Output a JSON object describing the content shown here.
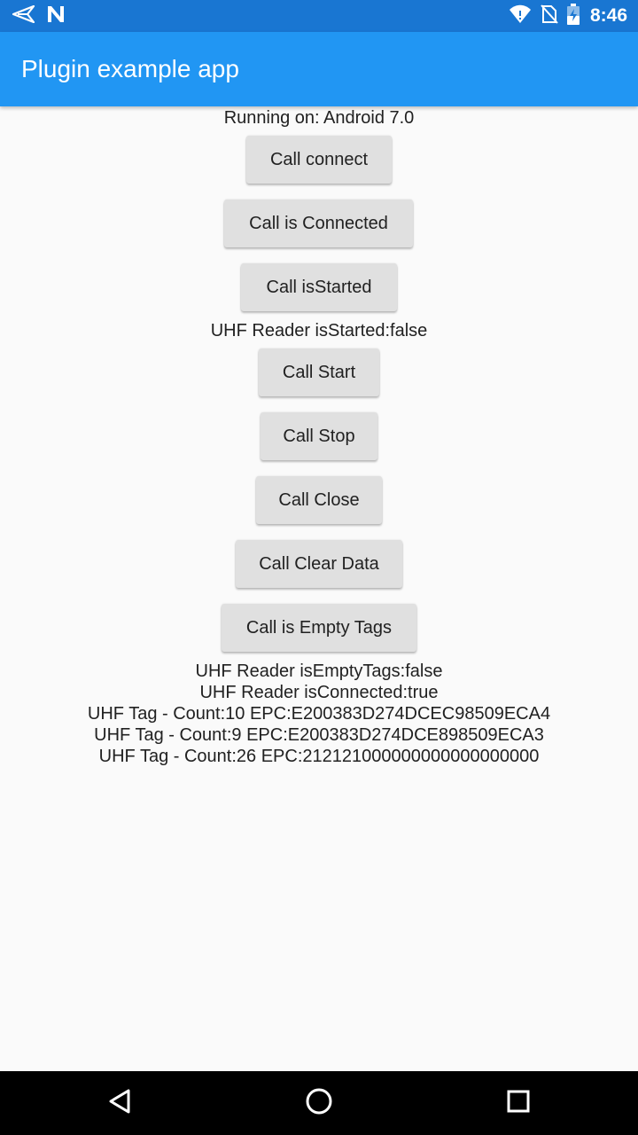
{
  "status_bar": {
    "time": "8:46",
    "icons": [
      "send-icon",
      "n-notification-icon",
      "wifi-icon",
      "no-sim-icon",
      "battery-charging-icon"
    ]
  },
  "app_bar": {
    "title": "Plugin example app",
    "color": "#2196F3",
    "status_color": "#1976D2"
  },
  "main": {
    "running_on": "Running on: Android 7.0",
    "buttons": {
      "connect": "Call connect",
      "is_connected": "Call is Connected",
      "is_started": "Call isStarted",
      "start": "Call Start",
      "stop": "Call Stop",
      "close": "Call Close",
      "clear_data": "Call Clear Data",
      "is_empty_tags": "Call is Empty Tags"
    },
    "is_started_status": "UHF Reader isStarted:false",
    "is_empty_tags_status": "UHF Reader isEmptyTags:false",
    "is_connected_status": "UHF Reader isConnected:true",
    "tags": [
      "UHF Tag - Count:10 EPC:E200383D274DCEC98509ECA4",
      "UHF Tag - Count:9 EPC:E200383D274DCE898509ECA3",
      "UHF Tag - Count:26 EPC:212121000000000000000000"
    ]
  },
  "nav_bar": {
    "icons": [
      "back-icon",
      "home-icon",
      "recents-icon"
    ]
  }
}
